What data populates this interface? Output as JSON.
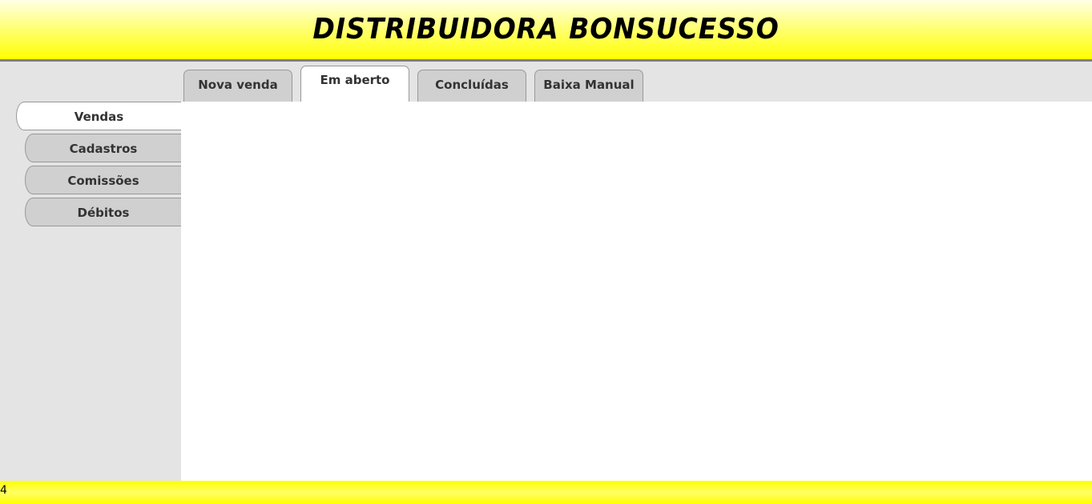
{
  "header": {
    "title": "DISTRIBUIDORA BONSUCESSO"
  },
  "sidebar": {
    "items": [
      {
        "label": "Vendas",
        "active": true
      },
      {
        "label": "Cadastros",
        "active": false
      },
      {
        "label": "Comissões",
        "active": false
      },
      {
        "label": "Débitos",
        "active": false
      }
    ]
  },
  "tabs": {
    "items": [
      {
        "label": "Nova venda",
        "active": false
      },
      {
        "label": "Em aberto",
        "active": true
      },
      {
        "label": "Concluídas",
        "active": false
      },
      {
        "label": "Baixa Manual",
        "active": false
      }
    ]
  },
  "footer": {
    "text": "4"
  },
  "colors": {
    "header_yellow": "#ffff00",
    "sidebar_bg": "#e4e4e4",
    "tab_inactive": "#d0d0d0",
    "tab_active": "#ffffff"
  }
}
